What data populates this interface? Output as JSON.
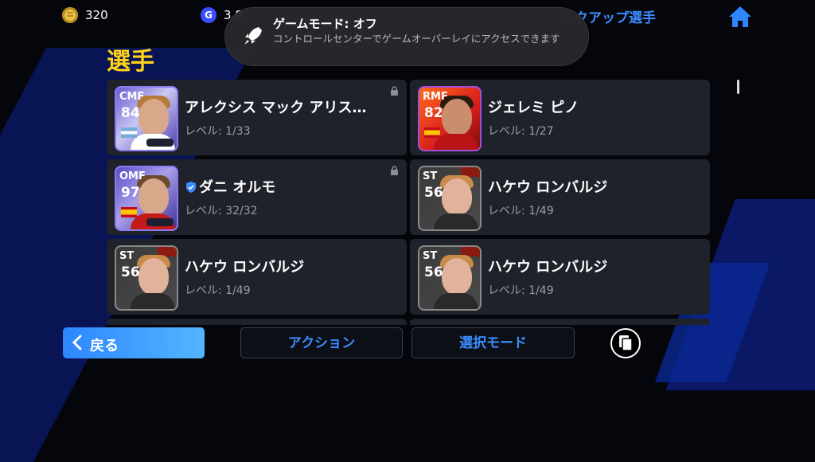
{
  "topbar": {
    "coins": "320",
    "gp_label": "G",
    "gp_value": "3,8",
    "lineup_label": "ックアップ選手"
  },
  "toast": {
    "title": "ゲームモード: オフ",
    "message": "コントロールセンターでゲームオーバーレイにアクセスできます"
  },
  "page_title": "選手",
  "players": [
    {
      "position": "CMF",
      "rating": "84",
      "name": "アレクシス マック アリス…",
      "level": "レベル: 1/33",
      "locked": true,
      "verified": false,
      "style": "cmf"
    },
    {
      "position": "RMF",
      "rating": "82",
      "name": "ジェレミ ピノ",
      "level": "レベル: 1/27",
      "locked": false,
      "verified": false,
      "style": "rmf"
    },
    {
      "position": "OMF",
      "rating": "97",
      "name": "ダニ オルモ",
      "level": "レベル: 32/32",
      "locked": true,
      "verified": true,
      "style": "omf"
    },
    {
      "position": "ST",
      "rating": "56",
      "name": "ハケウ ロンバルジ",
      "level": "レベル: 1/49",
      "locked": false,
      "verified": false,
      "style": "st"
    },
    {
      "position": "ST",
      "rating": "56",
      "name": "ハケウ ロンバルジ",
      "level": "レベル: 1/49",
      "locked": false,
      "verified": false,
      "style": "st"
    },
    {
      "position": "ST",
      "rating": "56",
      "name": "ハケウ ロンバルジ",
      "level": "レベル: 1/49",
      "locked": false,
      "verified": false,
      "style": "st"
    }
  ],
  "bottom": {
    "back_label": "戻る",
    "action_label": "アクション",
    "select_mode_label": "選択モード"
  },
  "colors": {
    "accent_blue": "#3b8cff",
    "title_yellow": "#ffd21a",
    "card_bg": "#20222b"
  }
}
